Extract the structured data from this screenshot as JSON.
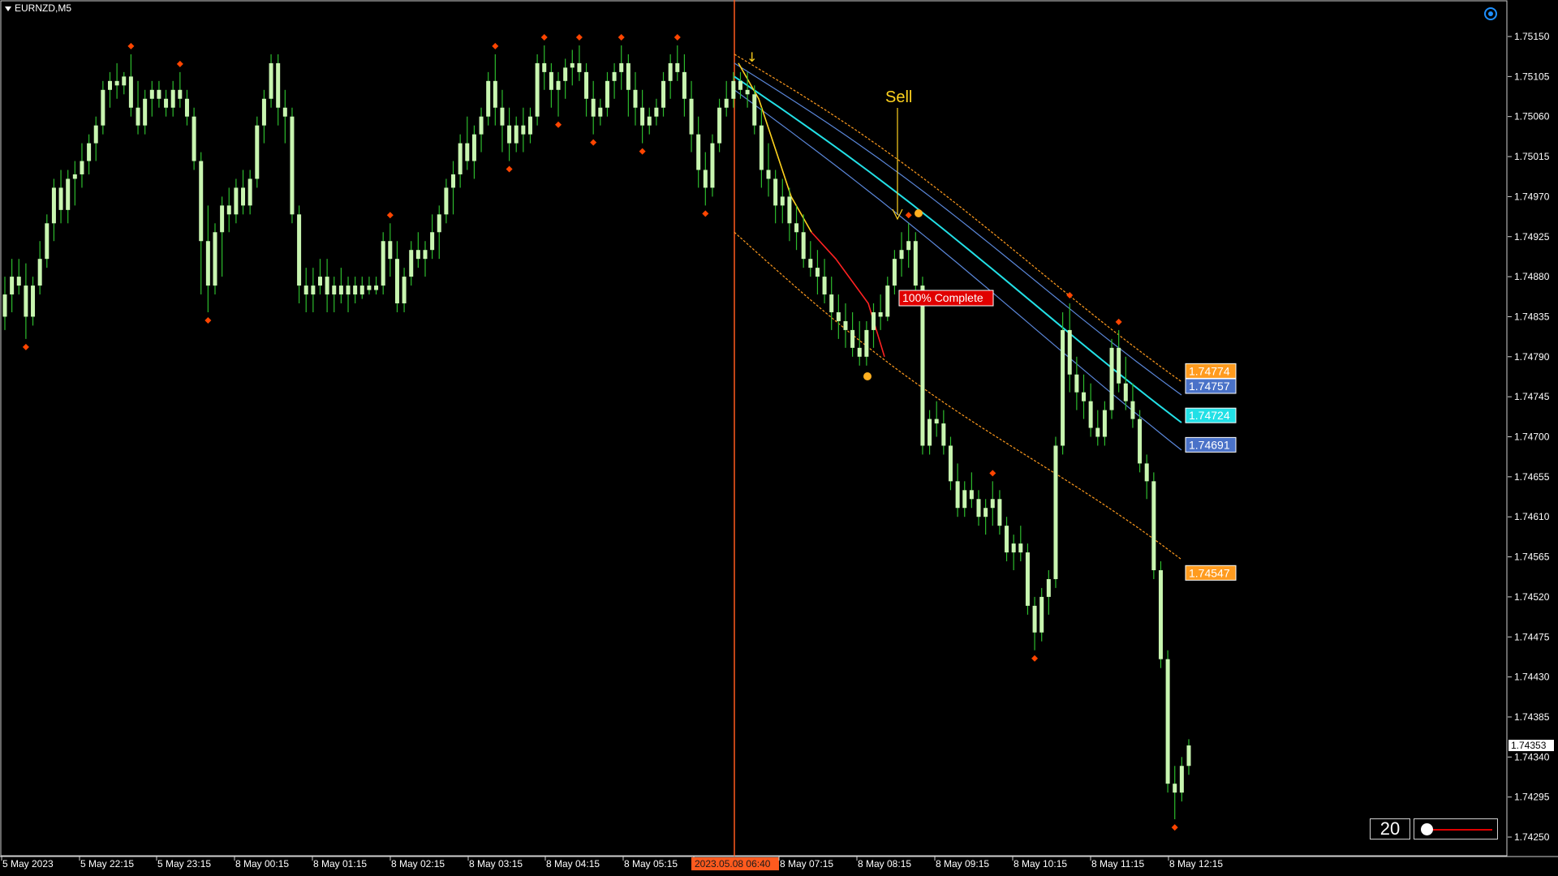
{
  "window": {
    "symbol": "EURNZD,M5"
  },
  "colors": {
    "background": "#000000",
    "candle": "#c8f5b0",
    "wick": "#2dbb2d",
    "fractal": "#ff4500",
    "vline": "#ff5a1e",
    "band_outer": "#ff9b1e",
    "band_mid": "#5a86d8",
    "band_center": "#22e0e6",
    "trend_down": "#ff2222",
    "trend_sign": "#ffd21e",
    "sell_text": "#ffd21e",
    "complete_bg": "#e00000",
    "axis_text": "#ffffff"
  },
  "chart_data": {
    "type": "candlestick",
    "y_axis": {
      "ylim": [
        1.7423,
        1.75175
      ],
      "ticks": [
        "1.75150",
        "1.75105",
        "1.75060",
        "1.75015",
        "1.74970",
        "1.74925",
        "1.74880",
        "1.74835",
        "1.74790",
        "1.74745",
        "1.74700",
        "1.74655",
        "1.74610",
        "1.74565",
        "1.74520",
        "1.74475",
        "1.74430",
        "1.74385",
        "1.74340",
        "1.74295",
        "1.74250"
      ],
      "current_price": "1.74353"
    },
    "x_axis": {
      "ticks": [
        "5 May 2023",
        "5 May 22:15",
        "5 May 23:15",
        "8 May 00:15",
        "8 May 01:15",
        "8 May 02:15",
        "8 May 03:15",
        "8 May 04:15",
        "8 May 05:15",
        "2023.05.08 06:40",
        "8 May 07:15",
        "8 May 08:15",
        "8 May 09:15",
        "8 May 10:15",
        "8 May 11:15",
        "8 May 12:15"
      ],
      "highlight_label": "2023.05.08 06:40"
    },
    "price_labels": [
      {
        "value": "1.74774",
        "color": "#ff9b1e"
      },
      {
        "value": "1.74757",
        "color": "#4a72c8"
      },
      {
        "value": "1.74724",
        "color": "#22e0e6"
      },
      {
        "value": "1.74691",
        "color": "#4a72c8"
      },
      {
        "value": "1.74547",
        "color": "#ff9b1e"
      }
    ],
    "annotations": {
      "sell": "Sell",
      "complete": "100% Complete"
    },
    "candles_ohlc": [
      [
        1.74835,
        1.7488,
        1.7482,
        1.7486
      ],
      [
        1.7486,
        1.749,
        1.7484,
        1.7488
      ],
      [
        1.7488,
        1.749,
        1.7486,
        1.7487
      ],
      [
        1.7487,
        1.74895,
        1.7481,
        1.74835
      ],
      [
        1.74835,
        1.7488,
        1.74825,
        1.7487
      ],
      [
        1.7487,
        1.7492,
        1.7486,
        1.749
      ],
      [
        1.749,
        1.7495,
        1.7489,
        1.7494
      ],
      [
        1.7494,
        1.7499,
        1.7492,
        1.7498
      ],
      [
        1.7498,
        1.75,
        1.7494,
        1.74955
      ],
      [
        1.74955,
        1.75,
        1.7494,
        1.7499
      ],
      [
        1.7499,
        1.7501,
        1.7496,
        1.74995
      ],
      [
        1.74995,
        1.7503,
        1.7498,
        1.7501
      ],
      [
        1.7501,
        1.7504,
        1.74995,
        1.7503
      ],
      [
        1.7503,
        1.7506,
        1.7501,
        1.7505
      ],
      [
        1.7505,
        1.751,
        1.7504,
        1.7509
      ],
      [
        1.7509,
        1.7511,
        1.7507,
        1.751
      ],
      [
        1.751,
        1.7512,
        1.7508,
        1.75095
      ],
      [
        1.75095,
        1.7511,
        1.75085,
        1.75105
      ],
      [
        1.75105,
        1.7513,
        1.7506,
        1.7507
      ],
      [
        1.7507,
        1.751,
        1.7504,
        1.7505
      ],
      [
        1.7505,
        1.7509,
        1.7504,
        1.7508
      ],
      [
        1.7508,
        1.751,
        1.7506,
        1.7509
      ],
      [
        1.7509,
        1.751,
        1.7507,
        1.7508
      ],
      [
        1.7508,
        1.7509,
        1.7506,
        1.7507
      ],
      [
        1.7507,
        1.751,
        1.7506,
        1.7509
      ],
      [
        1.7509,
        1.7511,
        1.7507,
        1.7508
      ],
      [
        1.7508,
        1.7509,
        1.7505,
        1.7506
      ],
      [
        1.7506,
        1.7507,
        1.75,
        1.7501
      ],
      [
        1.7501,
        1.7502,
        1.7486,
        1.7492
      ],
      [
        1.7492,
        1.7496,
        1.7484,
        1.7487
      ],
      [
        1.7487,
        1.7494,
        1.7486,
        1.7493
      ],
      [
        1.7493,
        1.7497,
        1.7488,
        1.7496
      ],
      [
        1.7496,
        1.7498,
        1.7493,
        1.7495
      ],
      [
        1.7495,
        1.7499,
        1.7494,
        1.7498
      ],
      [
        1.7498,
        1.75,
        1.7495,
        1.7496
      ],
      [
        1.7496,
        1.75,
        1.7495,
        1.7499
      ],
      [
        1.7499,
        1.7506,
        1.7498,
        1.7505
      ],
      [
        1.7505,
        1.7509,
        1.7503,
        1.7508
      ],
      [
        1.7508,
        1.7513,
        1.7507,
        1.7512
      ],
      [
        1.7512,
        1.7513,
        1.7505,
        1.7507
      ],
      [
        1.7507,
        1.7509,
        1.7503,
        1.7506
      ],
      [
        1.7506,
        1.7507,
        1.7494,
        1.7495
      ],
      [
        1.7495,
        1.7496,
        1.7485,
        1.7487
      ],
      [
        1.7487,
        1.7489,
        1.7484,
        1.7486
      ],
      [
        1.7486,
        1.7489,
        1.7484,
        1.7487
      ],
      [
        1.7487,
        1.749,
        1.7486,
        1.7488
      ],
      [
        1.7488,
        1.749,
        1.7484,
        1.7486
      ],
      [
        1.7486,
        1.7488,
        1.7484,
        1.7487
      ],
      [
        1.7487,
        1.7489,
        1.7485,
        1.7486
      ],
      [
        1.7486,
        1.7488,
        1.7484,
        1.7487
      ],
      [
        1.7487,
        1.7488,
        1.7485,
        1.7486
      ],
      [
        1.7486,
        1.7488,
        1.74855,
        1.7487
      ],
      [
        1.7487,
        1.7488,
        1.7486,
        1.74865
      ],
      [
        1.74865,
        1.7488,
        1.7486,
        1.7487
      ],
      [
        1.7487,
        1.7493,
        1.7486,
        1.7492
      ],
      [
        1.7492,
        1.7494,
        1.7488,
        1.749
      ],
      [
        1.749,
        1.7492,
        1.7484,
        1.7485
      ],
      [
        1.7485,
        1.7489,
        1.7484,
        1.7488
      ],
      [
        1.7488,
        1.7492,
        1.7487,
        1.7491
      ],
      [
        1.7491,
        1.7493,
        1.7489,
        1.749
      ],
      [
        1.749,
        1.7492,
        1.7488,
        1.7491
      ],
      [
        1.7491,
        1.7495,
        1.749,
        1.7493
      ],
      [
        1.7493,
        1.7496,
        1.749,
        1.7495
      ],
      [
        1.7495,
        1.7499,
        1.7494,
        1.7498
      ],
      [
        1.7498,
        1.7501,
        1.7495,
        1.74995
      ],
      [
        1.74995,
        1.7504,
        1.7498,
        1.7503
      ],
      [
        1.7503,
        1.7506,
        1.75,
        1.7501
      ],
      [
        1.7501,
        1.7505,
        1.7499,
        1.7504
      ],
      [
        1.7504,
        1.7507,
        1.7502,
        1.7506
      ],
      [
        1.7506,
        1.7511,
        1.7505,
        1.751
      ],
      [
        1.751,
        1.7513,
        1.7505,
        1.7507
      ],
      [
        1.7507,
        1.7509,
        1.7502,
        1.7505
      ],
      [
        1.7505,
        1.7507,
        1.7501,
        1.7503
      ],
      [
        1.7503,
        1.7506,
        1.7502,
        1.7505
      ],
      [
        1.7505,
        1.7507,
        1.7502,
        1.7504
      ],
      [
        1.7504,
        1.7507,
        1.7503,
        1.7506
      ],
      [
        1.7506,
        1.7513,
        1.7505,
        1.7512
      ],
      [
        1.7512,
        1.7514,
        1.7509,
        1.7511
      ],
      [
        1.7511,
        1.7512,
        1.7507,
        1.7509
      ],
      [
        1.7509,
        1.7511,
        1.7506,
        1.751
      ],
      [
        1.751,
        1.75125,
        1.7508,
        1.75115
      ],
      [
        1.75115,
        1.75135,
        1.75095,
        1.7512
      ],
      [
        1.7512,
        1.7514,
        1.751,
        1.7511
      ],
      [
        1.7511,
        1.7512,
        1.7506,
        1.7508
      ],
      [
        1.7508,
        1.751,
        1.7504,
        1.7506
      ],
      [
        1.7506,
        1.7508,
        1.7505,
        1.7507
      ],
      [
        1.7507,
        1.7511,
        1.7506,
        1.751
      ],
      [
        1.751,
        1.7512,
        1.7508,
        1.7511
      ],
      [
        1.7511,
        1.7514,
        1.7509,
        1.7512
      ],
      [
        1.7512,
        1.7513,
        1.7506,
        1.7509
      ],
      [
        1.7509,
        1.7511,
        1.7505,
        1.7507
      ],
      [
        1.7507,
        1.7509,
        1.7503,
        1.7505
      ],
      [
        1.7505,
        1.7507,
        1.7504,
        1.7506
      ],
      [
        1.7506,
        1.7508,
        1.7505,
        1.7507
      ],
      [
        1.7507,
        1.7511,
        1.7506,
        1.751
      ],
      [
        1.751,
        1.7513,
        1.7508,
        1.7512
      ],
      [
        1.7512,
        1.7514,
        1.751,
        1.7511
      ],
      [
        1.7511,
        1.7513,
        1.7506,
        1.7508
      ],
      [
        1.7508,
        1.751,
        1.7502,
        1.7504
      ],
      [
        1.7504,
        1.7506,
        1.7498,
        1.75
      ],
      [
        1.75,
        1.7502,
        1.7496,
        1.7498
      ],
      [
        1.7498,
        1.7504,
        1.7497,
        1.7503
      ],
      [
        1.7503,
        1.7508,
        1.7502,
        1.7507
      ],
      [
        1.7507,
        1.751,
        1.7506,
        1.7508
      ],
      [
        1.7508,
        1.7511,
        1.7507,
        1.751
      ],
      [
        1.751,
        1.7511,
        1.7508,
        1.7509
      ],
      [
        1.7509,
        1.7511,
        1.7507,
        1.75085
      ],
      [
        1.75085,
        1.75095,
        1.7504,
        1.7505
      ],
      [
        1.7505,
        1.7507,
        1.7498,
        1.75
      ],
      [
        1.75,
        1.7503,
        1.7497,
        1.7499
      ],
      [
        1.7499,
        1.75,
        1.7494,
        1.7496
      ],
      [
        1.7496,
        1.7499,
        1.7494,
        1.7497
      ],
      [
        1.7497,
        1.7498,
        1.7492,
        1.7494
      ],
      [
        1.7494,
        1.7496,
        1.7491,
        1.7493
      ],
      [
        1.7493,
        1.7495,
        1.7489,
        1.749
      ],
      [
        1.749,
        1.7492,
        1.7488,
        1.7489
      ],
      [
        1.7489,
        1.7491,
        1.7486,
        1.7488
      ],
      [
        1.7488,
        1.749,
        1.7485,
        1.7486
      ],
      [
        1.7486,
        1.7488,
        1.7482,
        1.7484
      ],
      [
        1.7484,
        1.7486,
        1.7481,
        1.7483
      ],
      [
        1.7483,
        1.7485,
        1.748,
        1.7482
      ],
      [
        1.7482,
        1.7484,
        1.7479,
        1.748
      ],
      [
        1.748,
        1.7483,
        1.7478,
        1.7479
      ],
      [
        1.7479,
        1.7483,
        1.7478,
        1.7482
      ],
      [
        1.7482,
        1.7485,
        1.748,
        1.7484
      ],
      [
        1.7484,
        1.7486,
        1.7482,
        1.74835
      ],
      [
        1.74835,
        1.7488,
        1.7483,
        1.7487
      ],
      [
        1.7487,
        1.7491,
        1.7486,
        1.749
      ],
      [
        1.749,
        1.7493,
        1.7488,
        1.7491
      ],
      [
        1.7491,
        1.7494,
        1.7489,
        1.7492
      ],
      [
        1.7492,
        1.7493,
        1.7486,
        1.7487
      ],
      [
        1.7487,
        1.7488,
        1.7468,
        1.7469
      ],
      [
        1.7469,
        1.7473,
        1.7468,
        1.7472
      ],
      [
        1.7472,
        1.7474,
        1.747,
        1.74715
      ],
      [
        1.74715,
        1.7473,
        1.7468,
        1.7469
      ],
      [
        1.7469,
        1.747,
        1.7464,
        1.7465
      ],
      [
        1.7465,
        1.7467,
        1.7461,
        1.7462
      ],
      [
        1.7462,
        1.7465,
        1.7461,
        1.7464
      ],
      [
        1.7464,
        1.7466,
        1.7462,
        1.7463
      ],
      [
        1.7463,
        1.7464,
        1.746,
        1.7461
      ],
      [
        1.7461,
        1.7463,
        1.7459,
        1.7462
      ],
      [
        1.7462,
        1.7465,
        1.746,
        1.7463
      ],
      [
        1.7463,
        1.7464,
        1.7459,
        1.746
      ],
      [
        1.746,
        1.7461,
        1.7456,
        1.7457
      ],
      [
        1.7457,
        1.7459,
        1.7455,
        1.7458
      ],
      [
        1.7458,
        1.746,
        1.7456,
        1.7457
      ],
      [
        1.7457,
        1.7458,
        1.745,
        1.7451
      ],
      [
        1.7451,
        1.7452,
        1.7446,
        1.7448
      ],
      [
        1.7448,
        1.7453,
        1.7447,
        1.7452
      ],
      [
        1.7452,
        1.7455,
        1.745,
        1.7454
      ],
      [
        1.7454,
        1.747,
        1.7453,
        1.7469
      ],
      [
        1.7469,
        1.7484,
        1.7468,
        1.7482
      ],
      [
        1.7482,
        1.7485,
        1.7475,
        1.7477
      ],
      [
        1.7477,
        1.7479,
        1.7473,
        1.7475
      ],
      [
        1.7475,
        1.7477,
        1.7472,
        1.7474
      ],
      [
        1.7474,
        1.7476,
        1.747,
        1.7471
      ],
      [
        1.7471,
        1.7473,
        1.7469,
        1.747
      ],
      [
        1.747,
        1.7474,
        1.7469,
        1.7473
      ],
      [
        1.7473,
        1.7481,
        1.7472,
        1.748
      ],
      [
        1.748,
        1.7482,
        1.7475,
        1.7476
      ],
      [
        1.7476,
        1.7479,
        1.7473,
        1.7474
      ],
      [
        1.7474,
        1.7476,
        1.7471,
        1.7472
      ],
      [
        1.7472,
        1.7473,
        1.7466,
        1.7467
      ],
      [
        1.7467,
        1.7468,
        1.7463,
        1.7465
      ],
      [
        1.7465,
        1.7466,
        1.7454,
        1.7455
      ],
      [
        1.7455,
        1.7456,
        1.7444,
        1.7445
      ],
      [
        1.7445,
        1.7446,
        1.743,
        1.7431
      ],
      [
        1.7431,
        1.7433,
        1.7427,
        1.743
      ],
      [
        1.743,
        1.7434,
        1.7429,
        1.7433
      ],
      [
        1.7433,
        1.7436,
        1.7432,
        1.74353
      ]
    ],
    "bands": {
      "upper_outer_end": 1.74774,
      "upper_inner_end": 1.74757,
      "center_end": 1.74724,
      "lower_inner_end": 1.74691,
      "lower_outer_end": 1.74547
    }
  },
  "widgets": {
    "period_value": "20"
  }
}
